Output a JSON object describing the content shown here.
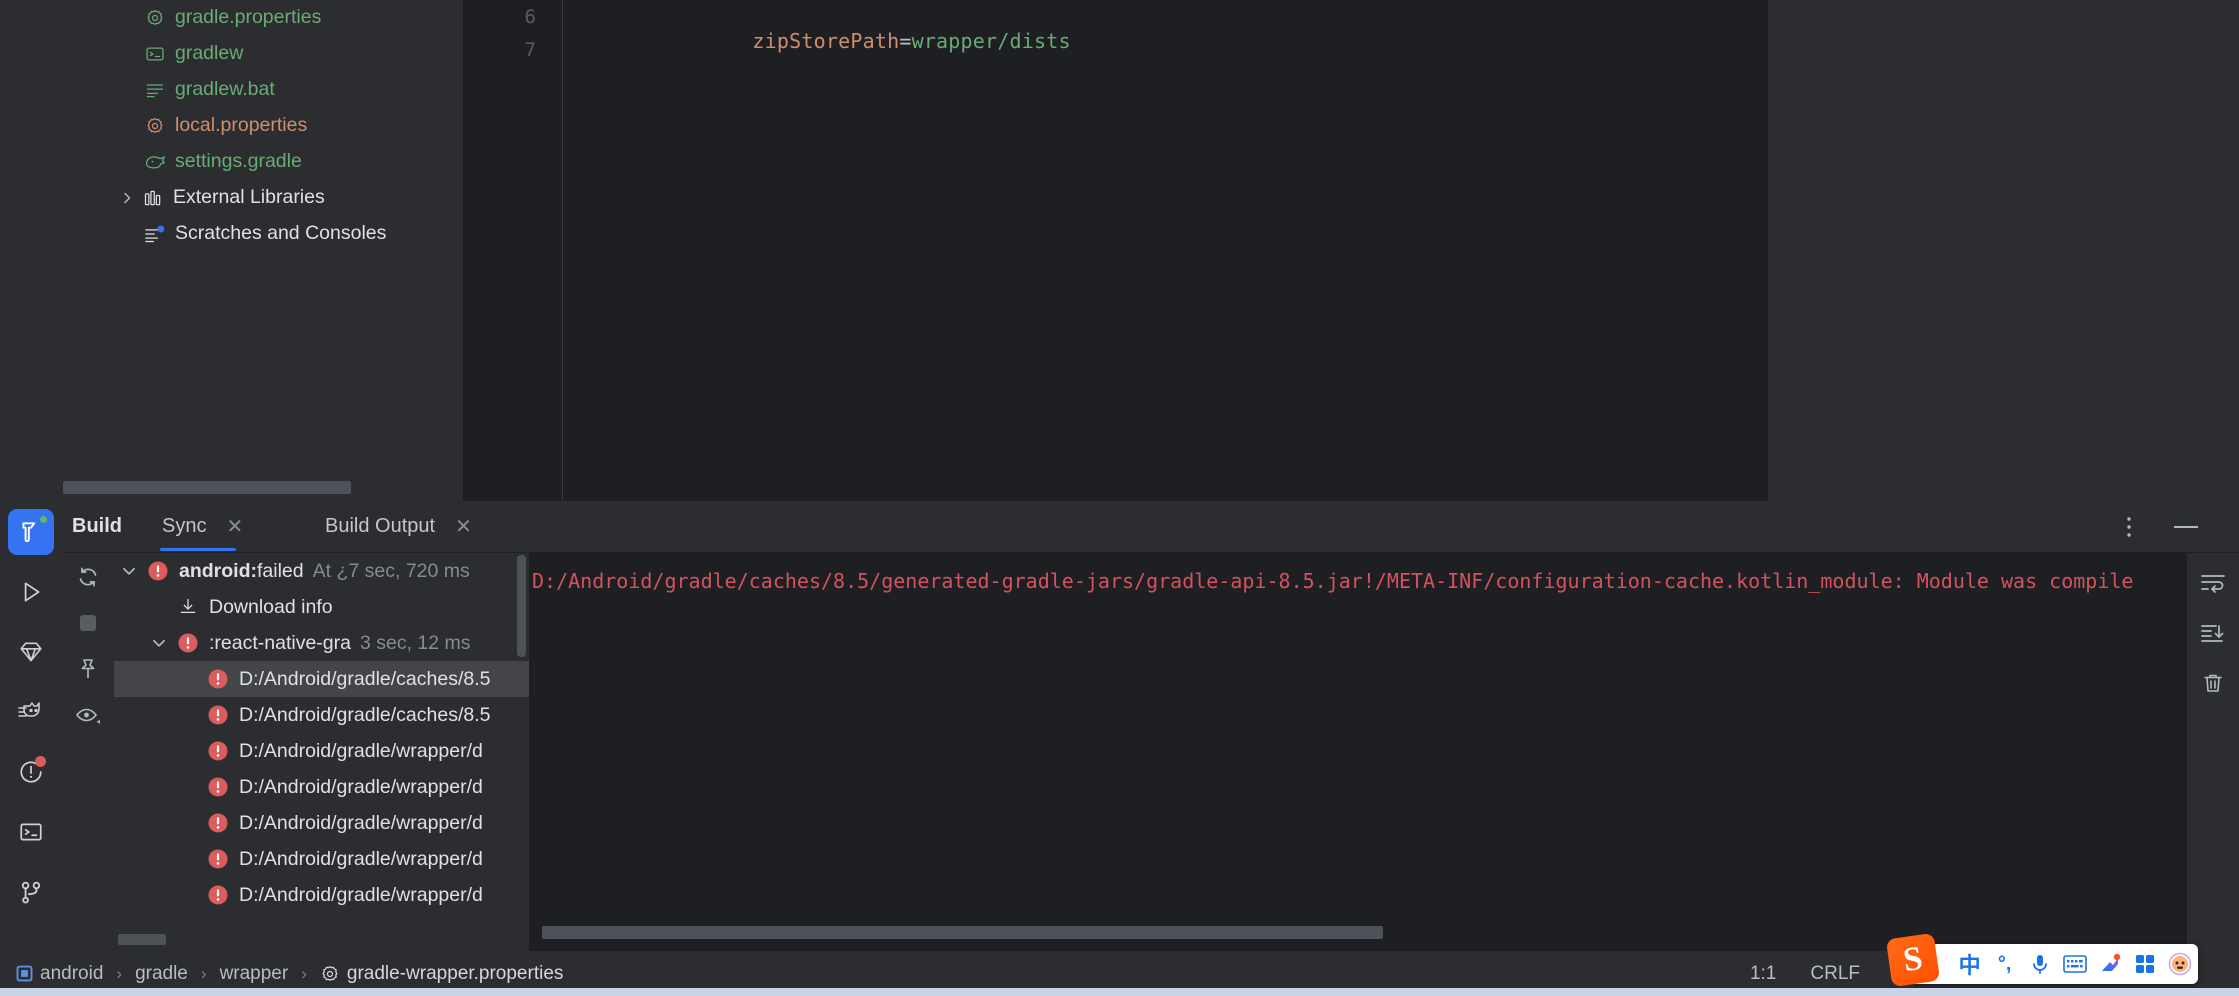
{
  "project_tree": {
    "items": [
      {
        "label": "gradle.properties",
        "icon": "gear-icon",
        "color": "green",
        "arrow": false
      },
      {
        "label": "gradlew",
        "icon": "console-icon",
        "color": "green",
        "arrow": false
      },
      {
        "label": "gradlew.bat",
        "icon": "text-file-icon",
        "color": "green",
        "arrow": false
      },
      {
        "label": "local.properties",
        "icon": "gear-icon",
        "color": "orange",
        "arrow": false
      },
      {
        "label": "settings.gradle",
        "icon": "gradle-elephant-icon",
        "color": "green",
        "arrow": false
      },
      {
        "label": "External Libraries",
        "icon": "library-icon",
        "color": "white",
        "arrow": true
      },
      {
        "label": "Scratches and Consoles",
        "icon": "scratches-icon",
        "color": "white",
        "arrow": false
      }
    ]
  },
  "editor": {
    "line_numbers": [
      "6",
      "7"
    ],
    "code_key": "zipStorePath",
    "code_eq": "=",
    "code_value": "wrapper/dists",
    "key_color": "#cf8e6d",
    "value_color": "#6aab73"
  },
  "build_window": {
    "title": "Build",
    "tabs": [
      {
        "label": "Sync",
        "active": true,
        "closable": true
      },
      {
        "label": "Build Output",
        "active": false,
        "closable": true
      }
    ],
    "kebab_label": "⋮",
    "minimize_label": "—",
    "left_tools": [
      {
        "name": "rerun-sync-icon"
      },
      {
        "name": "stop-icon"
      },
      {
        "name": "pin-icon"
      },
      {
        "name": "eye-filter-icon"
      }
    ],
    "right_tools": [
      {
        "name": "soft-wrap-icon"
      },
      {
        "name": "scroll-to-end-icon"
      },
      {
        "name": "clear-all-icon"
      }
    ],
    "tree": [
      {
        "indent": 0,
        "arrow": "expanded",
        "icon": "error-icon",
        "bold_text": "android:",
        "text": " failed",
        "dim": "At ¿7 sec, 720 ms",
        "selected": false
      },
      {
        "indent": 1,
        "arrow": "none",
        "icon": "download-icon",
        "bold_text": "",
        "text": "Download info",
        "dim": "",
        "selected": false
      },
      {
        "indent": 1,
        "arrow": "expanded",
        "icon": "error-icon",
        "bold_text": "",
        "text": ":react-native-gra",
        "dim": "3 sec, 12 ms",
        "selected": false
      },
      {
        "indent": 2,
        "arrow": "none",
        "icon": "error-icon",
        "bold_text": "",
        "text": "D:/Android/gradle/caches/8.5",
        "dim": "",
        "selected": true
      },
      {
        "indent": 2,
        "arrow": "none",
        "icon": "error-icon",
        "bold_text": "",
        "text": "D:/Android/gradle/caches/8.5",
        "dim": "",
        "selected": false
      },
      {
        "indent": 2,
        "arrow": "none",
        "icon": "error-icon",
        "bold_text": "",
        "text": "D:/Android/gradle/wrapper/d",
        "dim": "",
        "selected": false
      },
      {
        "indent": 2,
        "arrow": "none",
        "icon": "error-icon",
        "bold_text": "",
        "text": "D:/Android/gradle/wrapper/d",
        "dim": "",
        "selected": false
      },
      {
        "indent": 2,
        "arrow": "none",
        "icon": "error-icon",
        "bold_text": "",
        "text": "D:/Android/gradle/wrapper/d",
        "dim": "",
        "selected": false
      },
      {
        "indent": 2,
        "arrow": "none",
        "icon": "error-icon",
        "bold_text": "",
        "text": "D:/Android/gradle/wrapper/d",
        "dim": "",
        "selected": false
      },
      {
        "indent": 2,
        "arrow": "none",
        "icon": "error-icon",
        "bold_text": "",
        "text": "D:/Android/gradle/wrapper/d",
        "dim": "",
        "selected": false
      }
    ],
    "detail_message": "D:/Android/gradle/caches/8.5/generated-gradle-jars/gradle-api-8.5.jar!/META-INF/configuration-cache.kotlin_module: Module was compile",
    "detail_color": "#d4525e"
  },
  "tool_rail": [
    {
      "name": "build-hammer-icon",
      "active": true,
      "badge": "green"
    },
    {
      "name": "run-icon",
      "active": false,
      "badge": "none"
    },
    {
      "name": "gradle-diamond-icon",
      "active": false,
      "badge": "none"
    },
    {
      "name": "logcat-cat-icon",
      "active": false,
      "badge": "none"
    },
    {
      "name": "problems-icon",
      "active": false,
      "badge": "red"
    },
    {
      "name": "terminal-icon",
      "active": false,
      "badge": "none"
    },
    {
      "name": "git-branch-icon",
      "active": false,
      "badge": "none"
    }
  ],
  "status_bar": {
    "breadcrumbs": [
      {
        "label": "android",
        "icon": "module-icon"
      },
      {
        "label": "gradle",
        "icon": "none"
      },
      {
        "label": "wrapper",
        "icon": "none"
      },
      {
        "label": "gradle-wrapper.properties",
        "icon": "gear-icon"
      }
    ],
    "separator": "›",
    "caret_position": "1:1",
    "line_separator": "CRLF",
    "ime": {
      "logo_text": "S",
      "items": [
        {
          "name": "chinese-mode-icon",
          "label": "中"
        },
        {
          "name": "punctuation-mode-icon",
          "label": "°,"
        },
        {
          "name": "microphone-icon",
          "label": ""
        },
        {
          "name": "keyboard-icon",
          "label": ""
        },
        {
          "name": "magic-toolbox-icon",
          "label": ""
        },
        {
          "name": "apps-grid-icon",
          "label": ""
        },
        {
          "name": "avatar-icon",
          "label": ""
        }
      ]
    }
  },
  "colors": {
    "accent": "#3573f0",
    "error": "#db5c5c",
    "panel_bg": "#2b2d30",
    "editor_bg": "#1e1f22",
    "selection": "#43454a"
  }
}
